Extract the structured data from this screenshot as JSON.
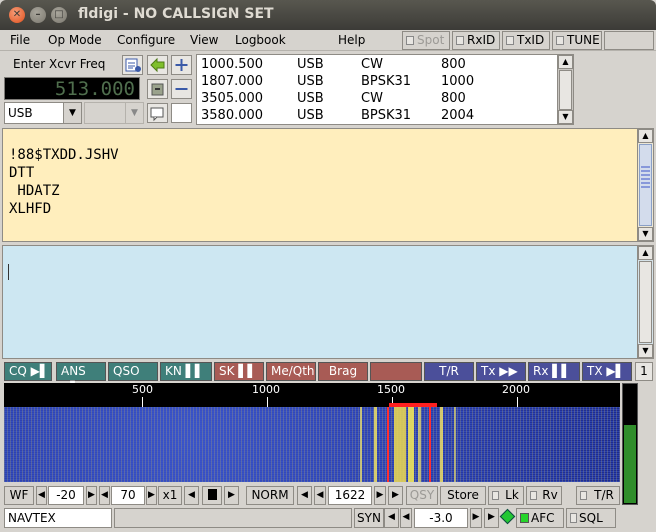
{
  "window": {
    "title": "fldigi - NO CALLSIGN SET"
  },
  "menu": {
    "items": [
      "File",
      "Op Mode",
      "Configure",
      "View",
      "Logbook",
      "Help"
    ],
    "toggles": [
      {
        "label": "Spot",
        "enabled": false
      },
      {
        "label": "RxID",
        "enabled": true
      },
      {
        "label": "TxID",
        "enabled": true
      },
      {
        "label": "TUNE",
        "enabled": true
      }
    ]
  },
  "rig": {
    "label": "Enter Xcvr Freq",
    "frequency": "513.000",
    "mode": "USB",
    "bandwidth": ""
  },
  "freq_list": [
    {
      "freq": "1000.500",
      "sb": "USB",
      "mode": "CW",
      "offset": "800"
    },
    {
      "freq": "1807.000",
      "sb": "USB",
      "mode": "BPSK31",
      "offset": "1000"
    },
    {
      "freq": "3505.000",
      "sb": "USB",
      "mode": "CW",
      "offset": "800"
    },
    {
      "freq": "3580.000",
      "sb": "USB",
      "mode": "BPSK31",
      "offset": "2004"
    }
  ],
  "rx_text": [
    "",
    "!88$TXDD.JSHV",
    "DTT",
    " HDATZ",
    "XLHFD"
  ],
  "tx_text": "",
  "macros": [
    {
      "label": "CQ",
      "color": "#3f7f7a"
    },
    {
      "label": "ANS",
      "color": "#3f7f7a"
    },
    {
      "label": "QSO",
      "color": "#3f7f7a"
    },
    {
      "label": "KN",
      "color": "#3f7f7a"
    },
    {
      "label": "SK",
      "color": "#a85b55"
    },
    {
      "label": "Me/Qth",
      "color": "#a85b55"
    },
    {
      "label": "Brag",
      "color": "#a85b55"
    },
    {
      "label": "",
      "color": "#a85b55"
    },
    {
      "label": "T/R",
      "color": "#4b4f9a"
    },
    {
      "label": "Tx",
      "color": "#4b4f9a"
    },
    {
      "label": "Rx",
      "color": "#4b4f9a"
    },
    {
      "label": "TX",
      "color": "#4b4f9a"
    }
  ],
  "macro_set": "1",
  "scale": {
    "labels": [
      "500",
      "1000",
      "1500",
      "2000"
    ]
  },
  "controls": {
    "wf_label": "WF",
    "ref_level": "-20",
    "range": "70",
    "zoom": "x1",
    "mode": "NORM",
    "carrier": "1622",
    "qsy": "QSY",
    "store": "Store",
    "lk": "Lk",
    "rv": "Rv",
    "tr": "T/R"
  },
  "status": {
    "mode": "NAVTEX",
    "syn": "SYN",
    "offset": "-3.0",
    "afc": "AFC",
    "sql": "SQL"
  }
}
